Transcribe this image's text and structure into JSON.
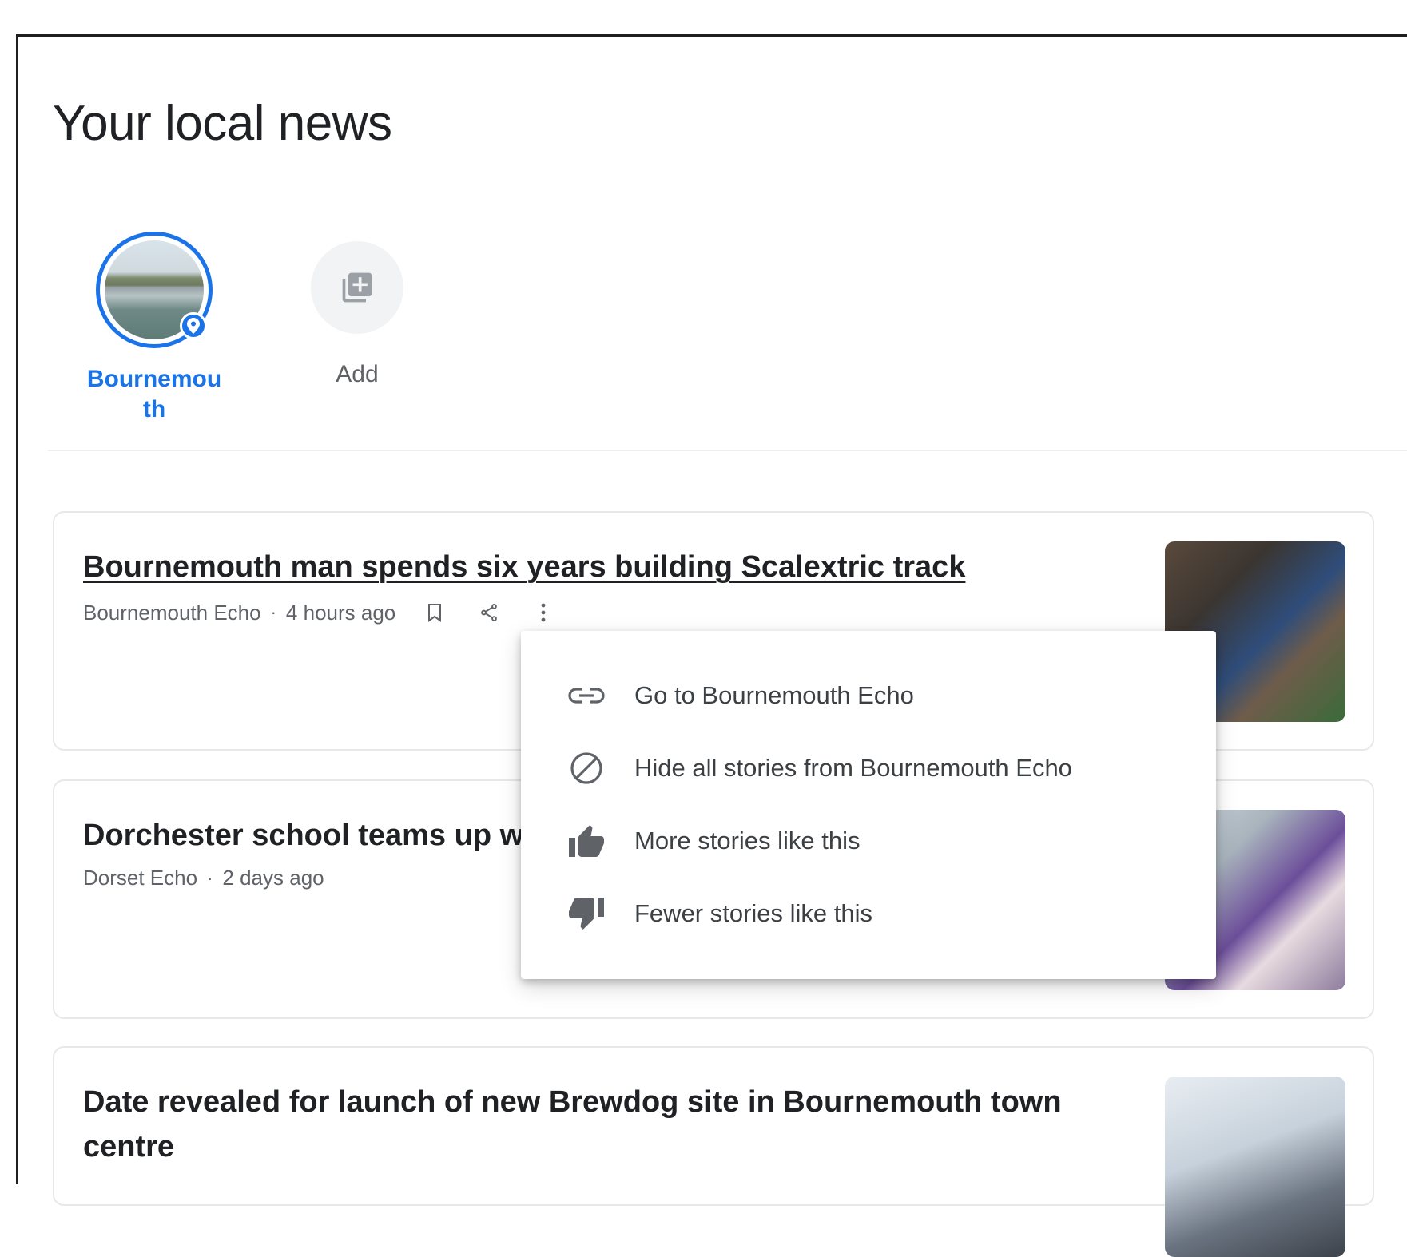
{
  "page": {
    "title": "Your local news"
  },
  "locations": [
    {
      "label_line1": "Bournemou",
      "label_line2": "th",
      "icon": "location-pin-icon"
    },
    {
      "label": "Add",
      "icon": "add-library-icon"
    }
  ],
  "articles": [
    {
      "headline": "Bournemouth man spends six years building Scalextric track",
      "source": "Bournemouth Echo",
      "time": "4 hours ago"
    },
    {
      "headline": "Dorchester school teams up w",
      "source": "Dorset Echo",
      "time": "2 days ago"
    },
    {
      "headline": "Date revealed for launch of new Brewdog site in Bournemouth town centre"
    }
  ],
  "menu": {
    "items": [
      {
        "label": "Go to Bournemouth Echo",
        "icon": "link-icon"
      },
      {
        "label": "Hide all stories from Bournemouth Echo",
        "icon": "block-icon"
      },
      {
        "label": "More stories like this",
        "icon": "thumb-up-icon"
      },
      {
        "label": "Fewer stories like this",
        "icon": "thumb-down-icon"
      }
    ]
  },
  "colors": {
    "accent": "#1a73e8",
    "text": "#202124",
    "secondary": "#5f6368"
  }
}
